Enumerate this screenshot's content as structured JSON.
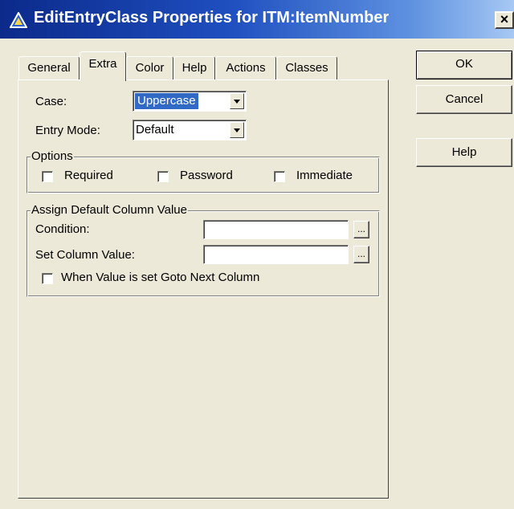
{
  "window": {
    "title": "EditEntryClass Properties for ITM:ItemNumber",
    "close_glyph": "×",
    "titlebar_color": "#1f4fc0"
  },
  "tabs": [
    {
      "label": "General",
      "active": false
    },
    {
      "label": "Extra",
      "active": true
    },
    {
      "label": "Color",
      "active": false
    },
    {
      "label": "Help",
      "active": false
    },
    {
      "label": "Actions",
      "active": false
    },
    {
      "label": "Classes",
      "active": false
    }
  ],
  "extra": {
    "case_label": "Case:",
    "case_value": "Uppercase",
    "entry_mode_label": "Entry Mode:",
    "entry_mode_value": "Default",
    "options": {
      "title": "Options",
      "required": "Required",
      "password": "Password",
      "immediate": "Immediate"
    },
    "assign": {
      "title": "Assign Default Column Value",
      "condition_label": "Condition:",
      "condition_value": "",
      "set_value_label": "Set Column Value:",
      "set_value_value": "",
      "goto_next_label": "When Value is set Goto Next Column",
      "ellipsis": "..."
    }
  },
  "buttons": {
    "ok": "OK",
    "cancel": "Cancel",
    "help": "Help"
  }
}
